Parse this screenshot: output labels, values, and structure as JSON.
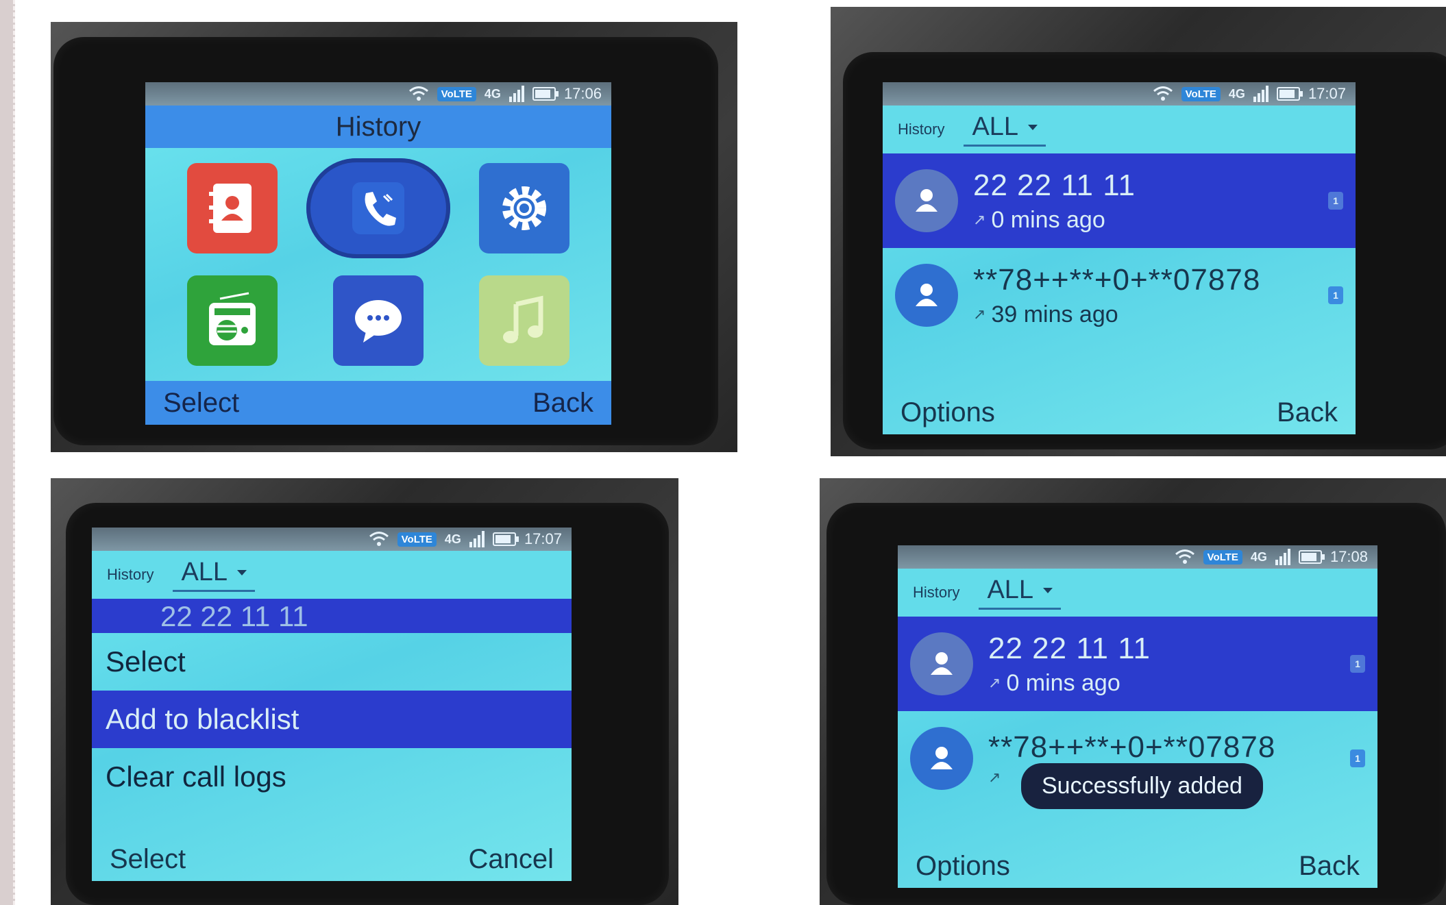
{
  "panels": {
    "p1": {
      "status": {
        "network": "4G",
        "time": "17:06",
        "volte": "VoLTE"
      },
      "title": "History",
      "apps": [
        {
          "icon": "contacts-icon",
          "color": "#e24b3f"
        },
        {
          "icon": "phone-icon",
          "color": "#2a56c8"
        },
        {
          "icon": "settings-icon",
          "color": "#2f6fd0"
        },
        {
          "icon": "radio-icon",
          "color": "#2fa33b"
        },
        {
          "icon": "messages-icon",
          "color": "#2f55c8"
        },
        {
          "icon": "music-icon",
          "color": "#b9d98a"
        }
      ],
      "softkeys": {
        "left": "Select",
        "right": "Back"
      }
    },
    "p2": {
      "status": {
        "network": "4G",
        "time": "17:07",
        "volte": "VoLTE"
      },
      "header": {
        "label": "History",
        "filter": "ALL"
      },
      "logs": [
        {
          "number": "22 22 11 11",
          "time": "0 mins ago",
          "sim": "1"
        },
        {
          "number": "**78++**+0+**07878",
          "time": "39 mins ago",
          "sim": "1"
        }
      ],
      "softkeys": {
        "left": "Options",
        "right": "Back"
      }
    },
    "p3": {
      "status": {
        "network": "4G",
        "time": "17:07",
        "volte": "VoLTE"
      },
      "header": {
        "label": "History",
        "filter": "ALL"
      },
      "peek_number": "22 22 11 11",
      "menu": [
        {
          "label": "Select"
        },
        {
          "label": "Add to blacklist"
        },
        {
          "label": "Clear call logs"
        }
      ],
      "softkeys": {
        "left": "Select",
        "right": "Cancel"
      }
    },
    "p4": {
      "status": {
        "network": "4G",
        "time": "17:08",
        "volte": "VoLTE"
      },
      "header": {
        "label": "History",
        "filter": "ALL"
      },
      "logs": [
        {
          "number": "22 22 11 11",
          "time": "0 mins ago",
          "sim": "1"
        },
        {
          "number": "**78++**+0+**07878",
          "time": "",
          "sim": "1"
        }
      ],
      "toast": "Successfully added",
      "softkeys": {
        "left": "Options",
        "right": "Back"
      }
    }
  }
}
